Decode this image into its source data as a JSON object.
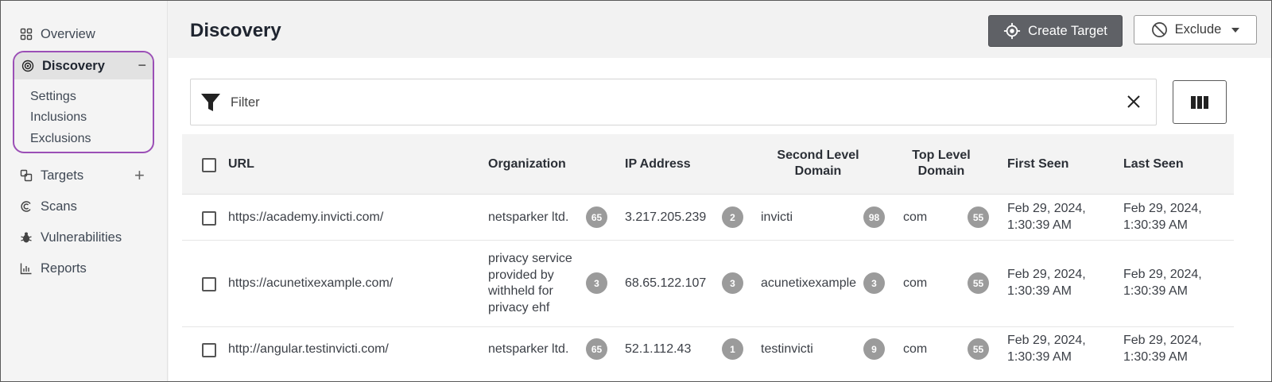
{
  "sidebar": {
    "overview": "Overview",
    "discovery": "Discovery",
    "discovery_sub": [
      "Settings",
      "Inclusions",
      "Exclusions"
    ],
    "targets": "Targets",
    "scans": "Scans",
    "vulnerabilities": "Vulnerabilities",
    "reports": "Reports"
  },
  "header": {
    "title": "Discovery",
    "create_target": "Create Target",
    "exclude": "Exclude"
  },
  "filter": {
    "placeholder": "Filter"
  },
  "table": {
    "columns": {
      "url": "URL",
      "organization": "Organization",
      "ip": "IP Address",
      "sld_line1": "Second Level",
      "sld_line2": "Domain",
      "tld_line1": "Top Level",
      "tld_line2": "Domain",
      "first_seen": "First Seen",
      "last_seen": "Last Seen"
    },
    "rows": [
      {
        "url": "https://academy.invicti.com/",
        "org": [
          "netsparker ltd."
        ],
        "org_count": "65",
        "ip": "3.217.205.239",
        "ip_count": "2",
        "sld": "invicti",
        "sld_count": "98",
        "tld": "com",
        "tld_count": "55",
        "first_seen": [
          "Feb 29, 2024,",
          "1:30:39 AM"
        ],
        "last_seen": [
          "Feb 29, 2024,",
          "1:30:39 AM"
        ]
      },
      {
        "url": "https://acunetixexample.com/",
        "org": [
          "privacy service",
          "provided by",
          "withheld for",
          "privacy ehf"
        ],
        "org_count": "3",
        "ip": "68.65.122.107",
        "ip_count": "3",
        "sld": "acunetixexample",
        "sld_count": "3",
        "tld": "com",
        "tld_count": "55",
        "first_seen": [
          "Feb 29, 2024,",
          "1:30:39 AM"
        ],
        "last_seen": [
          "Feb 29, 2024,",
          "1:30:39 AM"
        ]
      },
      {
        "url": "http://angular.testinvicti.com/",
        "org": [
          "netsparker ltd."
        ],
        "org_count": "65",
        "ip": "52.1.112.43",
        "ip_count": "1",
        "sld": "testinvicti",
        "sld_count": "9",
        "tld": "com",
        "tld_count": "55",
        "first_seen": [
          "Feb 29, 2024,",
          "1:30:39 AM"
        ],
        "last_seen": [
          "Feb 29, 2024,",
          "1:30:39 AM"
        ]
      }
    ]
  }
}
